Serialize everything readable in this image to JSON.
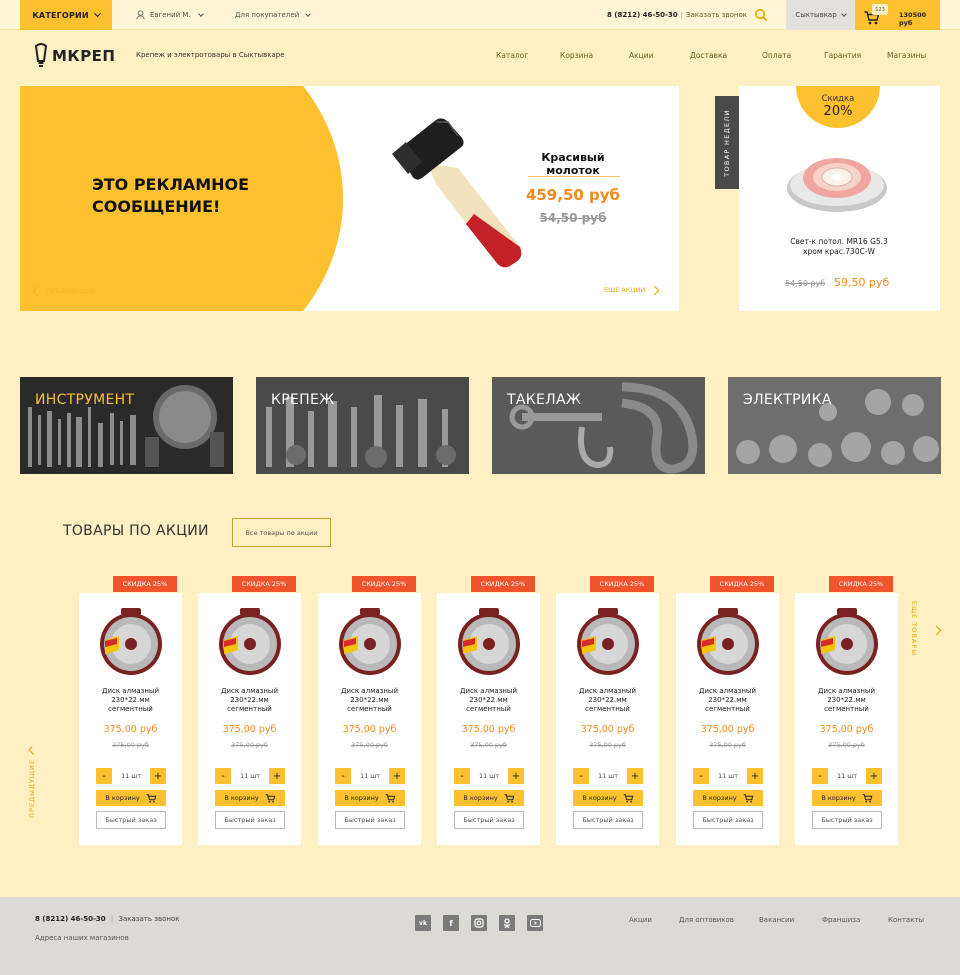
{
  "topbar": {
    "categories_label": "КАТЕГОРИИ",
    "user_name": "Евгений М.",
    "buyers_label": "Для покупателей",
    "phone": "8 (8212) 46-50-30",
    "call_label": "Заказать звонок",
    "city": "Сыктывкар",
    "cart_count": "123",
    "cart_sum": "130500 руб"
  },
  "header": {
    "logo": "МКРЕП",
    "tagline": "Крепеж и электротовары в Сыктывкаре",
    "nav": [
      "Каталог",
      "Корзина",
      "Акции",
      "Доставка",
      "Оплата",
      "Гарантия",
      "Магазины"
    ]
  },
  "banner": {
    "ad_text": "ЭТО РЕКЛАМНОЕ\nСООБЩЕНИЕ!",
    "prev_label": "ПРЕДЫДУЩИЕ",
    "next_label": "ЕЩЕ АКЦИИ",
    "product_name": "Красивый молоток",
    "price": "459,50 руб",
    "old_price": "54,50 руб"
  },
  "week": {
    "tab_label": "ТОВАР НЕДЕЛИ",
    "discount_label": "Скидка",
    "discount_value": "20%",
    "name": "Свет-к потол. MR16 G5.3 хром крас.730С-W",
    "old_price": "54,50 руб",
    "price": "59,50 руб"
  },
  "categories": [
    "ИНСТРУМЕНТ",
    "КРЕПЕЖ",
    "ТАКЕЛАЖ",
    "ЭЛЕКТРИКА"
  ],
  "categories_accent": "#fdc02f",
  "promo": {
    "title": "ТОВАРЫ ПО АКЦИИ",
    "all_label": "Все товары по акции",
    "prev_label": "ПРЕДЫДУЩИЕ",
    "more_label": "ЕЩЕ ТОВАРЫ",
    "products": [
      {
        "badge": "СКИДКА 25%",
        "name": "Диск алмазный\n230*22.мм\nсегментный",
        "price": "375,00 руб",
        "old": "375,00 руб",
        "qty": "11 шт",
        "cart": "В корзину",
        "quick": "Быстрый заказ"
      },
      {
        "badge": "СКИДКА 25%",
        "name": "Диск алмазный\n230*22.мм\nсегментный",
        "price": "375,00 руб",
        "old": "375,00 руб",
        "qty": "11 шт",
        "cart": "В корзину",
        "quick": "Быстрый заказ"
      },
      {
        "badge": "СКИДКА 25%",
        "name": "Диск алмазный\n230*22.мм\nсегментный",
        "price": "375,00 руб",
        "old": "375,00 руб",
        "qty": "11 шт",
        "cart": "В корзину",
        "quick": "Быстрый заказ"
      },
      {
        "badge": "СКИДКА 25%",
        "name": "Диск алмазный\n230*22.мм\nсегментный",
        "price": "375,00 руб",
        "old": "375,00 руб",
        "qty": "11 шт",
        "cart": "В корзину",
        "quick": "Быстрый заказ"
      },
      {
        "badge": "СКИДКА 25%",
        "name": "Диск алмазный\n230*22.мм\nсегментный",
        "price": "375,00 руб",
        "old": "375,00 руб",
        "qty": "11 шт",
        "cart": "В корзину",
        "quick": "Быстрый заказ"
      },
      {
        "badge": "СКИДКА 25%",
        "name": "Диск алмазный\n230*22.мм\nсегментный",
        "price": "375,00 руб",
        "old": "375,00 руб",
        "qty": "11 шт",
        "cart": "В корзину",
        "quick": "Быстрый заказ"
      },
      {
        "badge": "СКИДКА 25%",
        "name": "Диск алмазный\n230*22.мм\nсегментный",
        "price": "375,00 руб",
        "old": "375,00 руб",
        "qty": "11 шт",
        "cart": "В корзину",
        "quick": "Быстрый заказ"
      }
    ]
  },
  "footer": {
    "phone": "8 (8212) 46-50-30",
    "call_label": "Заказать звонок",
    "addresses": "Адреса наших магазинов",
    "socials": [
      "vk",
      "f",
      "instagram",
      "ok",
      "youtube"
    ],
    "nav": [
      "Акции",
      "Для оптовиков",
      "Вакансии",
      "Франшиза",
      "Контакты"
    ]
  },
  "colors": {
    "accent": "#fdc02f",
    "price": "#f28a1c",
    "badge": "#f0542d",
    "background": "#fef0c3"
  }
}
